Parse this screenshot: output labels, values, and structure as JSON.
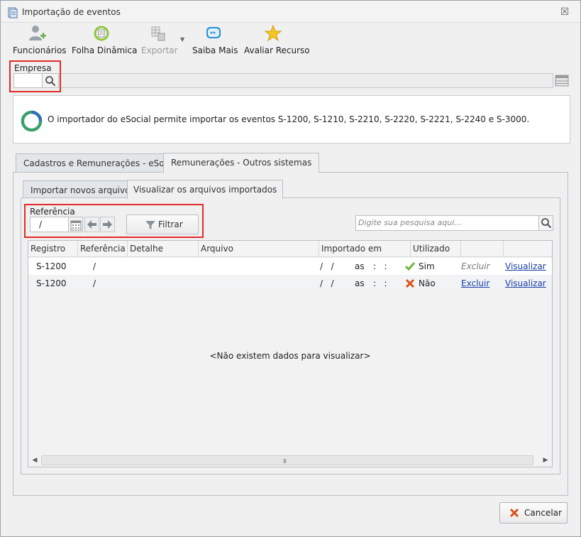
{
  "window": {
    "title": "Importação de eventos",
    "close_glyph": "☒"
  },
  "toolbar": {
    "funcionarios": "Funcionários",
    "folha_dinamica": "Folha Dinâmica",
    "exportar": "Exportar",
    "saiba_mais": "Saiba Mais",
    "avaliar_recurso": "Avaliar Recurso"
  },
  "empresa": {
    "label": "Empresa",
    "value": "",
    "description": ""
  },
  "info": {
    "text": "O importador do eSocial permite importar os eventos S-1200, S-1210, S-2210, S-2220, S-2221, S-2240 e S-3000."
  },
  "tabs": {
    "outer": [
      "Cadastros e Remunerações - eSocial",
      "Remunerações - Outros sistemas"
    ],
    "inner": [
      "Importar novos arquivos",
      "Visualizar os arquivos importados"
    ]
  },
  "filter": {
    "referencia_label": "Referência",
    "referencia_value": "/",
    "filtrar_label": "Filtrar",
    "search_placeholder": "Digite sua pesquisa aqui..."
  },
  "grid": {
    "columns": [
      "Registro",
      "Referência",
      "Detalhe",
      "Arquivo",
      "Importado em",
      "Utilizado",
      "",
      ""
    ],
    "rows": [
      {
        "registro": "S-1200",
        "referencia": "/",
        "detalhe": "",
        "arquivo": "",
        "importado_data": "/   /",
        "importado_as": "as",
        "importado_hora": ":   :",
        "utilizado": "Sim",
        "utilizado_icon": "check-icon",
        "excluir": "Excluir",
        "visualizar": "Visualizar"
      },
      {
        "registro": "S-1200",
        "referencia": "/",
        "detalhe": "",
        "arquivo": "",
        "importado_data": "/   /",
        "importado_as": "as",
        "importado_hora": ":   :",
        "utilizado": "Não",
        "utilizado_icon": "x-icon",
        "excluir": "Excluir",
        "visualizar": "Visualizar"
      }
    ],
    "empty_message": "<Não existem dados para visualizar>"
  },
  "buttons": {
    "cancelar": "Cancelar"
  },
  "colors": {
    "highlight_box": "#e22a2a",
    "link": "#1a3ea8",
    "check": "#6fb43a",
    "cross": "#d9531e"
  }
}
